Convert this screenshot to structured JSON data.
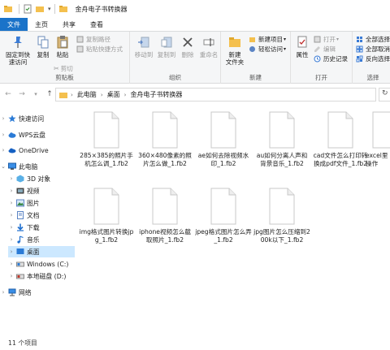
{
  "window": {
    "title": "金舟电子书转换器"
  },
  "ribbon_tabs": [
    {
      "label": "文件"
    },
    {
      "label": "主页"
    },
    {
      "label": "共享"
    },
    {
      "label": "查看"
    }
  ],
  "ribbon": {
    "clipboard": {
      "pin_label": "固定到快\n速访问",
      "copy_label": "复制",
      "paste_label": "粘贴",
      "copy_path": "复制路径",
      "paste_shortcut": "粘贴快捷方式",
      "cut": "剪切",
      "group_label": "剪贴板"
    },
    "organize": {
      "move_to": "移动到",
      "copy_to": "复制到",
      "delete": "删除",
      "rename": "重命名",
      "group_label": "组织"
    },
    "new": {
      "new_folder": "新建\n文件夹",
      "new_item": "新建项目",
      "easy_access": "轻松访问",
      "group_label": "新建"
    },
    "open": {
      "properties": "属性",
      "open": "打开",
      "edit": "编辑",
      "history": "历史记录",
      "group_label": "打开"
    },
    "select": {
      "select_all": "全部选择",
      "select_none": "全部取消",
      "invert": "反向选择",
      "group_label": "选择"
    }
  },
  "address": {
    "crumbs": [
      "此电脑",
      "桌面",
      "金舟电子书转换器"
    ]
  },
  "sidebar": {
    "items": [
      {
        "label": "快速访问"
      },
      {
        "label": "WPS云盘"
      },
      {
        "label": "OneDrive"
      },
      {
        "label": "此电脑"
      },
      {
        "label": "3D 对象"
      },
      {
        "label": "视频"
      },
      {
        "label": "图片"
      },
      {
        "label": "文档"
      },
      {
        "label": "下载"
      },
      {
        "label": "音乐"
      },
      {
        "label": "桌面"
      },
      {
        "label": "Windows (C:)"
      },
      {
        "label": "本地磁盘 (D:)"
      },
      {
        "label": "网络"
      }
    ]
  },
  "files": [
    {
      "name": "285×385的照片手机怎么调_1.fb2"
    },
    {
      "name": "360×480像素的照片怎么做_1.fb2"
    },
    {
      "name": "ae如何去除视频水印_1.fb2"
    },
    {
      "name": "au如何分离人声和背景音乐_1.fb2"
    },
    {
      "name": "cad文件怎么打印转换成pdf文件_1.fb2"
    },
    {
      "name": "excel里操作"
    },
    {
      "name": "img格式图片转换jpg_1.fb2"
    },
    {
      "name": "iphone视频怎么截取照片_1.fb2"
    },
    {
      "name": "jpeg格式图片怎么弄_1.fb2"
    },
    {
      "name": "jpg图片怎么压缩到200k以下_1.fb2"
    }
  ],
  "status": {
    "count": "11 个项目"
  },
  "colors": {
    "accent": "#1a73c9",
    "selected": "#cce8ff",
    "folder": "#f4c04e"
  }
}
